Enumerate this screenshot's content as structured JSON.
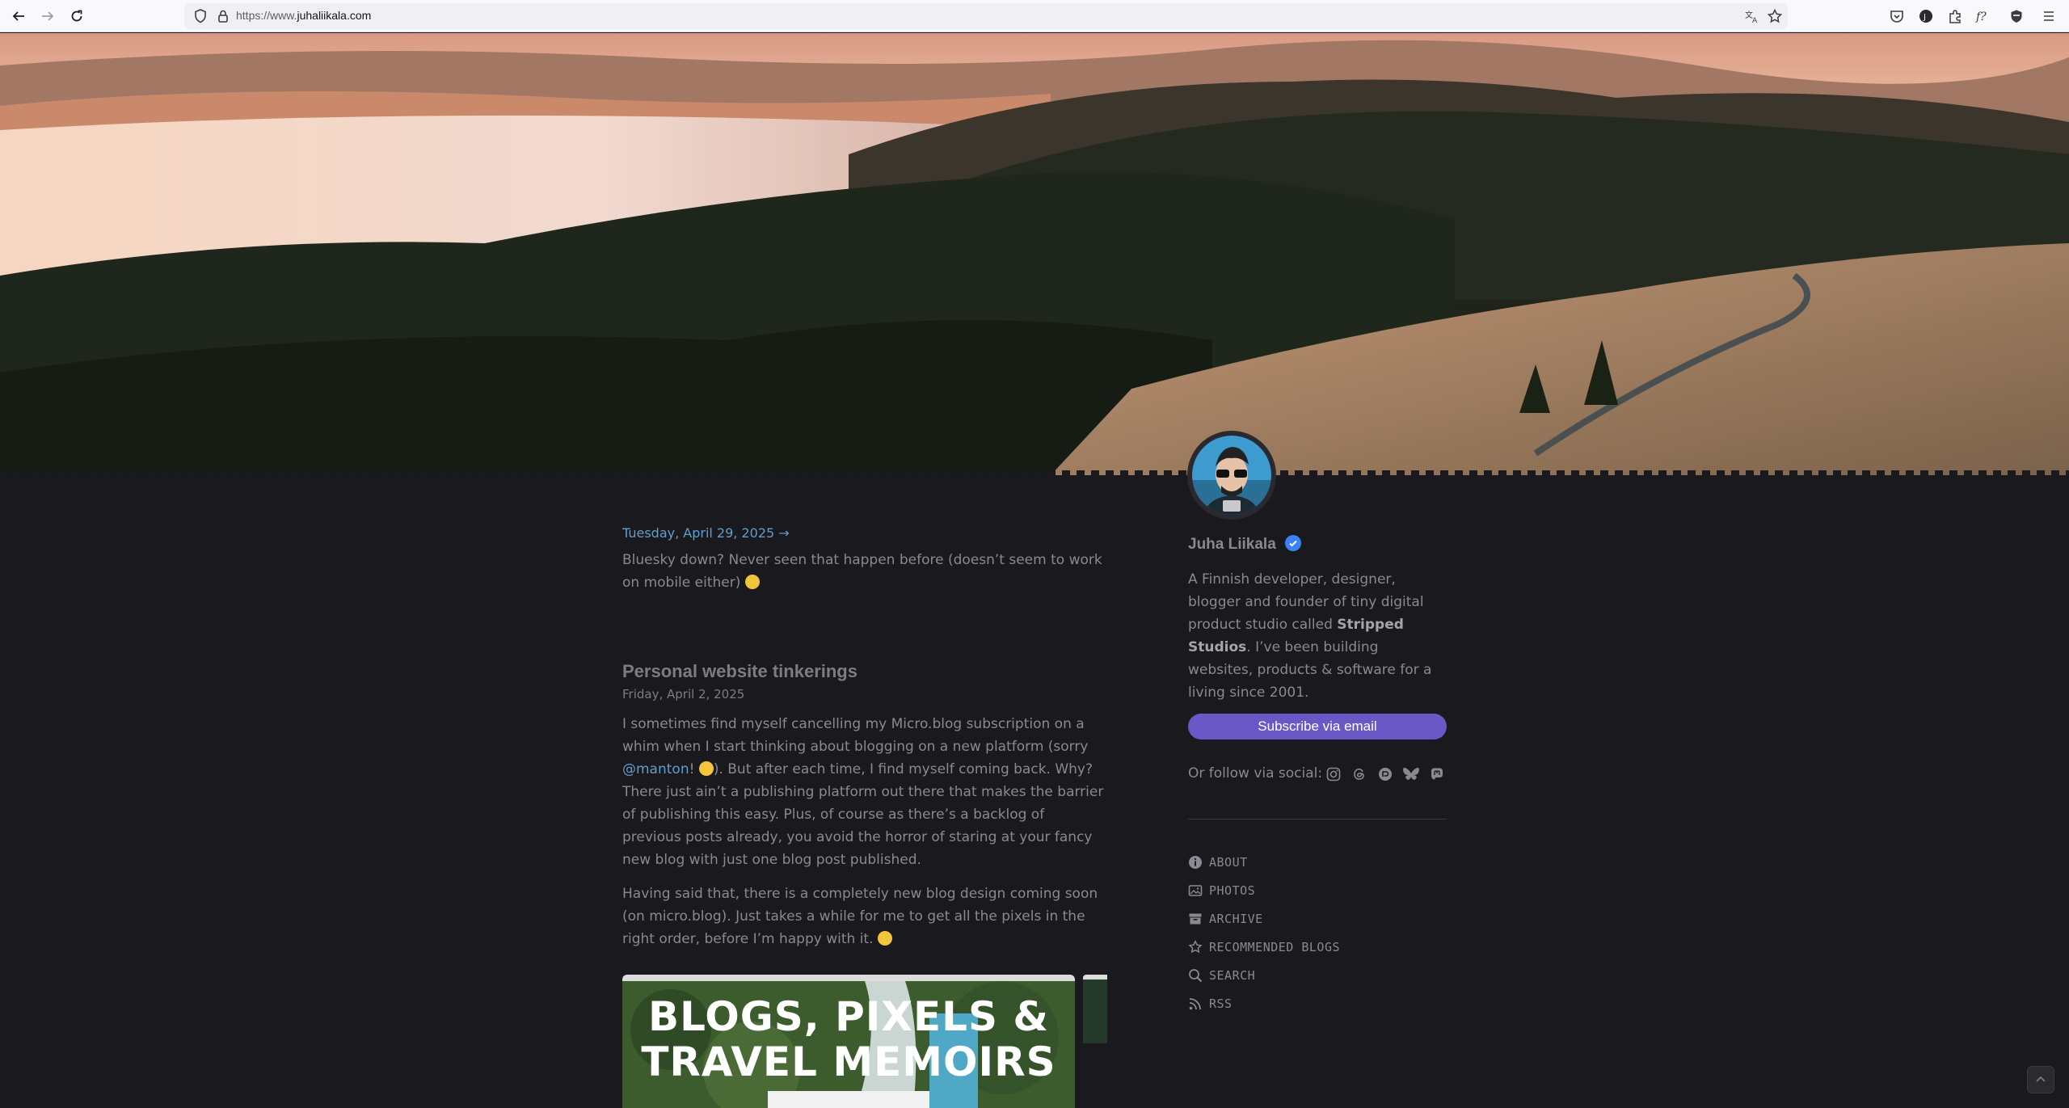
{
  "browser": {
    "url_prefix": "https://www.",
    "url_domain": "juhaliikala.com"
  },
  "posts": [
    {
      "date": "Tuesday, April 29, 2025 →",
      "text": "Bluesky down? Never seen that happen before (doesn’t seem to work on mobile either)"
    },
    {
      "title": "Personal website tinkerings",
      "date": "Friday, April 2, 2025",
      "p1_a": "I sometimes find myself cancelling my Micro.blog subscription on a whim when I start thinking about blogging on a new platform (sorry ",
      "p1_mention": "@manton",
      "p1_b": "! ",
      "p1_c": "). But after each time, I find myself coming back. Why? There just ain’t a publishing platform out there that makes the barrier of publishing this easy. Plus, of course as there’s a backlog of previous posts already, you avoid the horror of staring at your fancy new blog with just one blog post published.",
      "p2": "Having said that, there is a completely new blog design coming soon (on micro.blog). Just takes a while for me to get all the pixels in the right order, before I’m happy with it. ",
      "image_title_1": "BLOGS, PIXELS &",
      "image_title_2": "TRAVEL MEMOIRS"
    }
  ],
  "sidebar": {
    "author": "Juha Liikala",
    "bio_a": "A Finnish developer, designer, blogger and founder of tiny digital product studio called ",
    "bio_bold": "Stripped Studios",
    "bio_b": ". I’ve been building websites, products & software for a living since 2001.",
    "subscribe_label": "Subscribe via email",
    "social_label": "Or follow via social:",
    "social_icons": [
      "instagram-icon",
      "threads-icon",
      "pixelfed-icon",
      "bluesky-icon",
      "mastodon-icon"
    ],
    "menu": [
      {
        "label": "ABOUT",
        "icon": "info-icon"
      },
      {
        "label": "PHOTOS",
        "icon": "image-icon"
      },
      {
        "label": "ARCHIVE",
        "icon": "archive-icon"
      },
      {
        "label": "RECOMMENDED BLOGS",
        "icon": "star-icon"
      },
      {
        "label": "SEARCH",
        "icon": "search-icon"
      },
      {
        "label": "RSS",
        "icon": "rss-icon"
      }
    ]
  },
  "colors": {
    "background": "#1a191e",
    "link": "#5f9fd0",
    "subscribe": "#6b58c7",
    "verified": "#3a82f6"
  }
}
